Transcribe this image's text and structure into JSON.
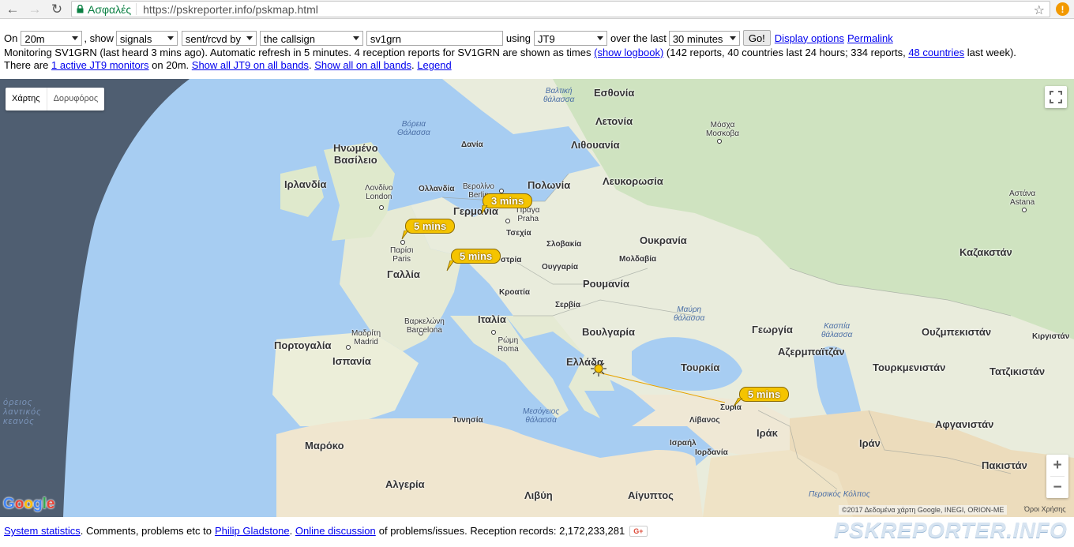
{
  "browser": {
    "secure_label": "Ασφαλές",
    "url": "https://pskreporter.info/pskmap.html"
  },
  "controls": {
    "on_label": "On",
    "band": "20m",
    "show_label": ", show",
    "show_value": "signals",
    "direction": "sent/rcvd by",
    "target": "the callsign",
    "callsign": "sv1grn",
    "using_label": "using",
    "mode": "JT9",
    "over_label": "over the last",
    "period": "30 minutes",
    "go_label": "Go!",
    "display_options": "Display options",
    "permalink": "Permalink"
  },
  "status": {
    "line1_text": "Monitoring SV1GRN (last heard 3 mins ago). Automatic refresh in 5 minutes. 4 reception reports for SV1GRN are shown as times",
    "show_logbook": "(show logbook)",
    "line1_mid": "(142 reports, 40 countries last 24 hours; 334 reports,",
    "countries_link": "48 countries",
    "line1_end": "last week).",
    "line2_a": "There are",
    "active_monitors": "1 active JT9 monitors",
    "line2_b": "on 20m.",
    "show_all_jt9": "Show all JT9 on all bands",
    "show_all": "Show all on all bands",
    "legend": "Legend"
  },
  "map": {
    "type_map": "Χάρτης",
    "type_satellite": "Δορυφόρος",
    "zoom_in": "+",
    "zoom_out": "−",
    "copyright": "©2017 Δεδομένα χάρτη Google, INEGI, ORION-ME",
    "terms": "Όροι Χρήσης",
    "google": [
      "G",
      "o",
      "o",
      "g",
      "l",
      "e"
    ],
    "countries": {
      "estonia": "Εσθονία",
      "latvia": "Λετονία",
      "lithuania": "Λιθουανία",
      "uk": "Ηνωμένο",
      "uk2": "Βασίλειο",
      "ireland": "Ιρλανδία",
      "netherlands": "Ολλανδία",
      "germany": "Γερμανία",
      "poland": "Πολωνία",
      "belarus": "Λευκορωσία",
      "czech": "Τσεχία",
      "slovakia": "Σλοβακία",
      "austria": "στρία",
      "ukraine": "Ουκρανία",
      "moldova": "Μολδαβία",
      "hungary": "Ουγγαρία",
      "france": "Γαλλία",
      "romania": "Ρουμανία",
      "croatia": "Κροατία",
      "serbia": "Σερβία",
      "italy": "Ιταλία",
      "bulgaria": "Βουλγαρία",
      "portugal": "Πορτογαλία",
      "spain": "Ισπανία",
      "greece": "Ελλάδα",
      "turkey": "Τουρκία",
      "georgia": "Γεωργία",
      "azerbaijan": "Αζερμπαϊτζάν",
      "kazakhstan": "Καζακστάν",
      "uzbekistan": "Ουζμπεκιστάν",
      "kyrgyzstan": "Κιργιστάν",
      "turkmenistan": "Τουρκμενιστάν",
      "tajikistan": "Τατζικιστάν",
      "afghanistan": "Αφγανιστάν",
      "iran": "Ιράν",
      "iraq": "Ιράκ",
      "pakistan": "Πακιστάν",
      "syria": "Συρία",
      "lebanon": "Λίβανος",
      "israel": "Ισραήλ",
      "jordan": "Ιορδανία",
      "tunisia": "Τυνησία",
      "morocco": "Μαρόκο",
      "algeria": "Αλγερία",
      "libya": "Λιβύη",
      "egypt": "Αίγυπτος",
      "denmark": "Δανία"
    },
    "cities": {
      "moscow_gr": "Μόσχα",
      "moscow": "Μοσκοβα",
      "astana_gr": "Αστάνα",
      "astana": "Astana",
      "london_gr": "Λονδίνο",
      "london": "London",
      "berlin_gr": "Βερολίνο",
      "berlin": "Berlin",
      "prague_gr": "Πράγα",
      "prague": "Praha",
      "paris_gr": "Παρίσι",
      "paris": "Paris",
      "barcelona_gr": "Βαρκελώνη",
      "barcelona": "Barcelona",
      "madrid_gr": "Μαδρίτη",
      "madrid": "Madrid",
      "rome_gr": "Ρώμη",
      "rome": "Roma"
    },
    "seas": {
      "baltic1": "Βαλτική",
      "baltic2": "θάλασσα",
      "north1": "Βόρεια",
      "north2": "Θάλασσα",
      "black1": "Μαύρη",
      "black2": "θάλασσα",
      "caspian1": "Κασπία",
      "caspian2": "θάλασσα",
      "med1": "Μεσόγειος",
      "med2": "θάλασσα",
      "persian": "Περσικός Κόλπος",
      "atlantic1": "όρειος",
      "atlantic2": "λαντικός",
      "atlantic3": "κεανός"
    },
    "reports": [
      "3 mins",
      "5 mins",
      "5 mins",
      "5 mins"
    ]
  },
  "footer": {
    "system_statistics": "System statistics",
    "comments_text": ". Comments, problems etc to",
    "author": "Philip Gladstone",
    "online_discussion": "Online discussion",
    "discussion_text": "of problems/issues. Reception records: 2,172,233,281",
    "gplus": "G+",
    "brand": "PSKREPORTER.INFO"
  }
}
